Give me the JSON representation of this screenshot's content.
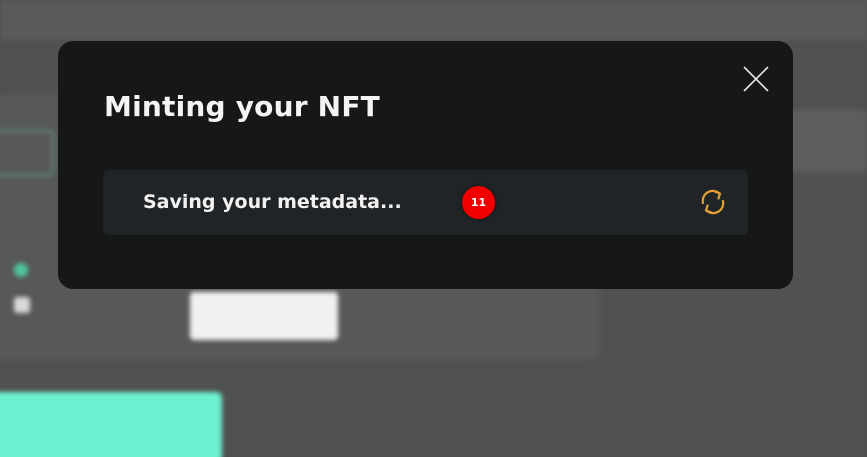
{
  "modal": {
    "title": "Minting your NFT",
    "close_icon": "close-icon",
    "status": {
      "text": "Saving your metadata...",
      "badge_count": "11",
      "icon": "refresh-icon",
      "icon_color": "#e3a12f"
    }
  },
  "background": {
    "accent": "#6cf0cf"
  }
}
